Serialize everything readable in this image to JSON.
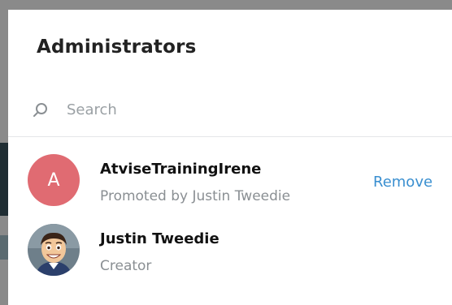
{
  "dialog": {
    "title": "Administrators"
  },
  "search": {
    "placeholder": "Search",
    "value": "",
    "icon": "search-icon"
  },
  "admins": [
    {
      "avatar_letter": "A",
      "avatar_color": "#e06b72",
      "name": "AtviseTrainingIrene",
      "subtitle": "Promoted by Justin Tweedie",
      "action_label": "Remove"
    },
    {
      "avatar_type": "photo",
      "name": "Justin Tweedie",
      "subtitle": "Creator"
    }
  ],
  "colors": {
    "accent": "#3a8fd0",
    "subtitle": "#8a8f93"
  }
}
